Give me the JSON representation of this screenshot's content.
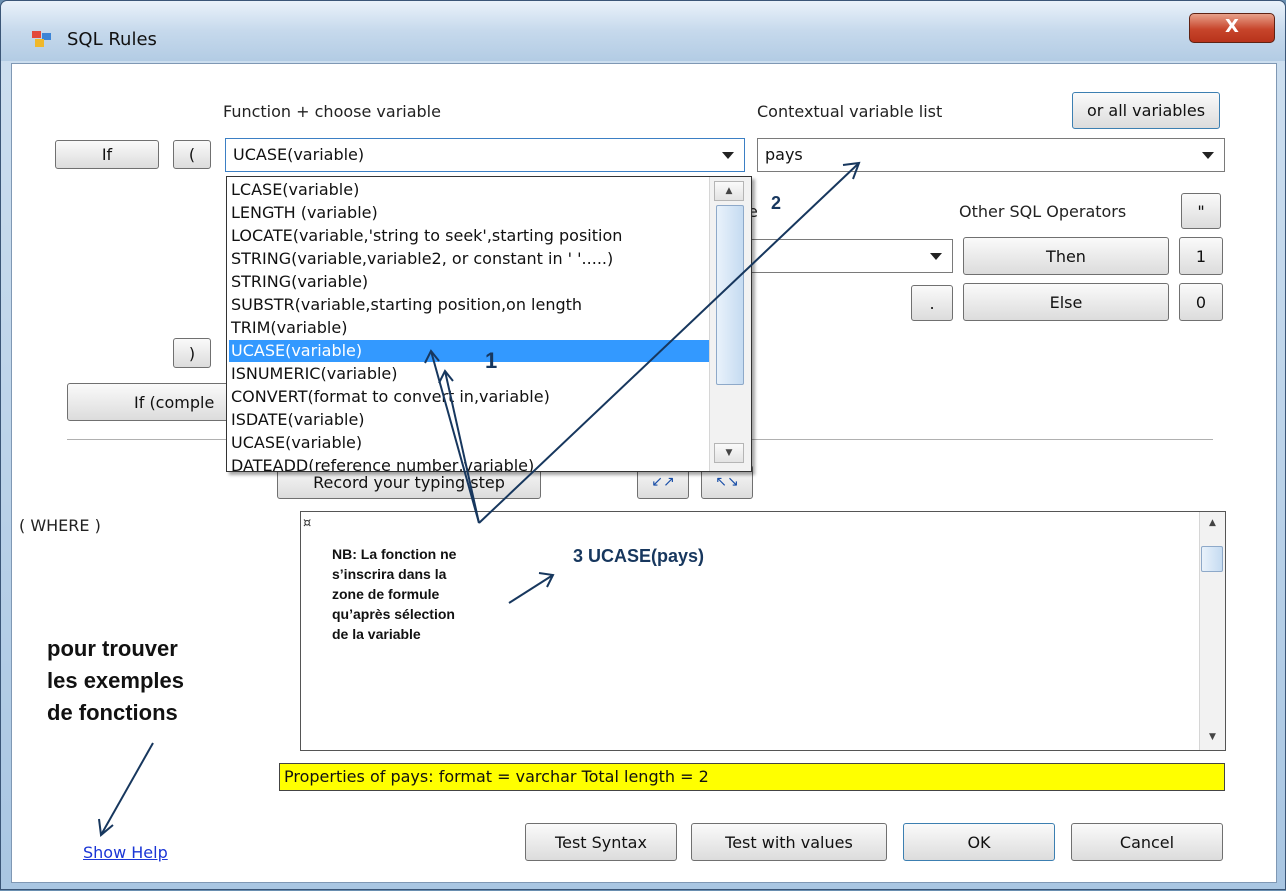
{
  "window": {
    "title": "SQL Rules",
    "close_glyph": "X"
  },
  "labels": {
    "function_choose": "Function + choose variable",
    "contextual_list": "Contextual variable list",
    "other_sql_ops": "Other SQL Operators",
    "where": "( WHERE )",
    "partial_e": "e"
  },
  "buttons": {
    "if": "If",
    "open_paren": "(",
    "close_paren": ")",
    "if_complex": "If (comple",
    "or_all_variables": "or all variables",
    "quote": "\"",
    "then": "Then",
    "one": "1",
    "else": "Else",
    "zero": "0",
    "dot": ".",
    "record_typing": "Record your typing step",
    "undo_glyph": "↙↗",
    "redo_glyph": "↖↘",
    "test_syntax": "Test Syntax",
    "test_values": "Test with values",
    "ok": "OK",
    "cancel": "Cancel"
  },
  "function_combo": {
    "value": "UCASE(variable)"
  },
  "variable_combo": {
    "value": "pays"
  },
  "function_options": [
    "LCASE(variable)",
    "LENGTH (variable)",
    "LOCATE(variable,'string to seek',starting position",
    "STRING(variable,variable2, or constant in ' '.....)",
    "STRING(variable)",
    "SUBSTR(variable,starting position,on length",
    "TRIM(variable)",
    "UCASE(variable)",
    "ISNUMERIC(variable)",
    "CONVERT(format to convert in,variable)",
    "ISDATE(variable)",
    "UCASE(variable)",
    "DATEADD(reference number,variable)"
  ],
  "selected_option_index": 7,
  "editor": {
    "marker": "¤"
  },
  "properties_text": "Properties of pays: format = varchar Total length = 2",
  "help_link": "Show Help",
  "annotations": {
    "step1": "1",
    "step2": "2",
    "step3": "3  UCASE(pays)",
    "nb": [
      "NB: La fonction ne",
      "s’inscrira dans la",
      "zone de formule",
      "qu’après sélection",
      "de la variable"
    ],
    "help_hint": [
      "pour trouver",
      "les exemples",
      "de fonctions"
    ],
    "color": "#17375e"
  },
  "colors": {
    "selection": "#3399ff",
    "properties_bg": "#ffff00",
    "link": "#1a35d6"
  }
}
